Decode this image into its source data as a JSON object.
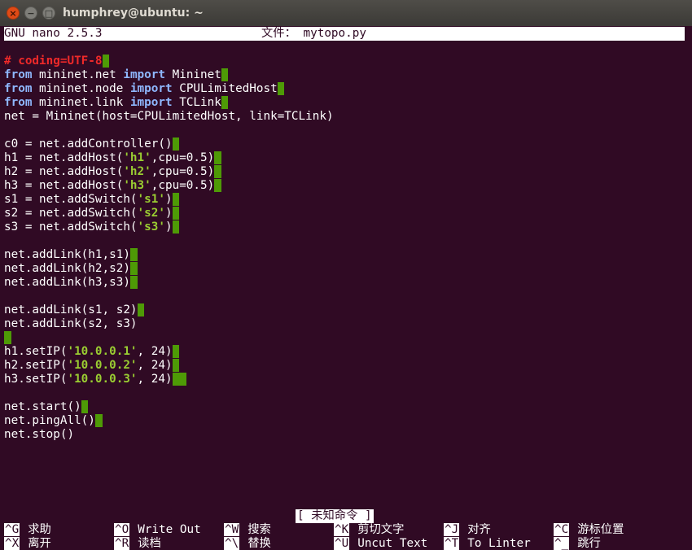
{
  "window": {
    "title": "humphrey@ubuntu: ~",
    "close_glyph": "×",
    "min_glyph": "−",
    "max_glyph": "□"
  },
  "nano": {
    "version": "GNU nano 2.5.3",
    "file_label": "文件：",
    "file_name": "mytopo.py",
    "status_message": "[ 未知命令 ]"
  },
  "code_lines": [
    [
      {
        "t": "#",
        "s": "cm"
      },
      {
        "t": " coding=UTF-8",
        "s": "cm"
      },
      {
        "t": " ",
        "s": "ws"
      }
    ],
    [
      {
        "t": "from",
        "s": "kw"
      },
      {
        "t": " mininet.net "
      },
      {
        "t": "import",
        "s": "kw"
      },
      {
        "t": " Mininet"
      },
      {
        "t": " ",
        "s": "ws"
      }
    ],
    [
      {
        "t": "from",
        "s": "kw"
      },
      {
        "t": " mininet.node "
      },
      {
        "t": "import",
        "s": "kw"
      },
      {
        "t": " CPULimitedHost"
      },
      {
        "t": " ",
        "s": "ws"
      }
    ],
    [
      {
        "t": "from",
        "s": "kw"
      },
      {
        "t": " mininet.link "
      },
      {
        "t": "import",
        "s": "kw"
      },
      {
        "t": " TCLink"
      },
      {
        "t": " ",
        "s": "ws"
      }
    ],
    [
      {
        "t": "net = Mininet(host=CPULimitedHost, link=TCLink)"
      }
    ],
    [],
    [
      {
        "t": "c0 = net.addController()"
      },
      {
        "t": " ",
        "s": "ws"
      }
    ],
    [
      {
        "t": "h1 = net.addHost("
      },
      {
        "t": "'h1'",
        "s": "str"
      },
      {
        "t": ",cpu=0.5)"
      },
      {
        "t": " ",
        "s": "ws"
      }
    ],
    [
      {
        "t": "h2 = net.addHost("
      },
      {
        "t": "'h2'",
        "s": "str"
      },
      {
        "t": ",cpu=0.5)"
      },
      {
        "t": " ",
        "s": "ws"
      }
    ],
    [
      {
        "t": "h3 = net.addHost("
      },
      {
        "t": "'h3'",
        "s": "str"
      },
      {
        "t": ",cpu=0.5)"
      },
      {
        "t": " ",
        "s": "ws"
      }
    ],
    [
      {
        "t": "s1 = net.addSwitch("
      },
      {
        "t": "'s1'",
        "s": "str"
      },
      {
        "t": ")"
      },
      {
        "t": " ",
        "s": "ws"
      }
    ],
    [
      {
        "t": "s2 = net.addSwitch("
      },
      {
        "t": "'s2'",
        "s": "str"
      },
      {
        "t": ")"
      },
      {
        "t": " ",
        "s": "ws"
      }
    ],
    [
      {
        "t": "s3 = net.addSwitch("
      },
      {
        "t": "'s3'",
        "s": "str"
      },
      {
        "t": ")"
      },
      {
        "t": " ",
        "s": "ws"
      }
    ],
    [],
    [
      {
        "t": "net.addLink(h1,s1)"
      },
      {
        "t": " ",
        "s": "ws"
      }
    ],
    [
      {
        "t": "net.addLink(h2,s2)"
      },
      {
        "t": " ",
        "s": "ws"
      }
    ],
    [
      {
        "t": "net.addLink(h3,s3)"
      },
      {
        "t": " ",
        "s": "ws"
      }
    ],
    [],
    [
      {
        "t": "net.addLink(s1, s2)"
      },
      {
        "t": " ",
        "s": "ws"
      }
    ],
    [
      {
        "t": "net.addLink(s2, s3)"
      }
    ],
    [
      {
        "t": " ",
        "s": "ws"
      }
    ],
    [
      {
        "t": "h1.setIP("
      },
      {
        "t": "'10.0.0.1'",
        "s": "str"
      },
      {
        "t": ", 24)"
      },
      {
        "t": " ",
        "s": "ws"
      }
    ],
    [
      {
        "t": "h2.setIP("
      },
      {
        "t": "'10.0.0.2'",
        "s": "str"
      },
      {
        "t": ", 24)"
      },
      {
        "t": " ",
        "s": "ws"
      }
    ],
    [
      {
        "t": "h3.setIP("
      },
      {
        "t": "'10.0.0.3'",
        "s": "str"
      },
      {
        "t": ", 24)"
      },
      {
        "t": "  ",
        "s": "ws"
      }
    ],
    [],
    [
      {
        "t": "net.start()"
      },
      {
        "t": " ",
        "s": "ws"
      }
    ],
    [
      {
        "t": "net.pingAll()"
      },
      {
        "t": " ",
        "s": "ws"
      }
    ],
    [
      {
        "t": "net.stop()"
      }
    ]
  ],
  "shortcuts_row1": [
    {
      "key": "^G",
      "label": "求助"
    },
    {
      "key": "^O",
      "label": "Write Out"
    },
    {
      "key": "^W",
      "label": "搜索"
    },
    {
      "key": "^K",
      "label": "剪切文字"
    },
    {
      "key": "^J",
      "label": "对齐"
    },
    {
      "key": "^C",
      "label": "游标位置"
    }
  ],
  "shortcuts_row2": [
    {
      "key": "^X",
      "label": "离开"
    },
    {
      "key": "^R",
      "label": "读档"
    },
    {
      "key": "^\\",
      "label": "替换"
    },
    {
      "key": "^U",
      "label": "Uncut Text"
    },
    {
      "key": "^T",
      "label": "To Linter"
    },
    {
      "key": "^_",
      "label": "跳行"
    }
  ],
  "colors": {
    "background": "#300a24",
    "keyword": "#8fb8ff",
    "string": "#9acd32",
    "comment": "#ef2929",
    "trailing_whitespace": "#4e9a06"
  }
}
